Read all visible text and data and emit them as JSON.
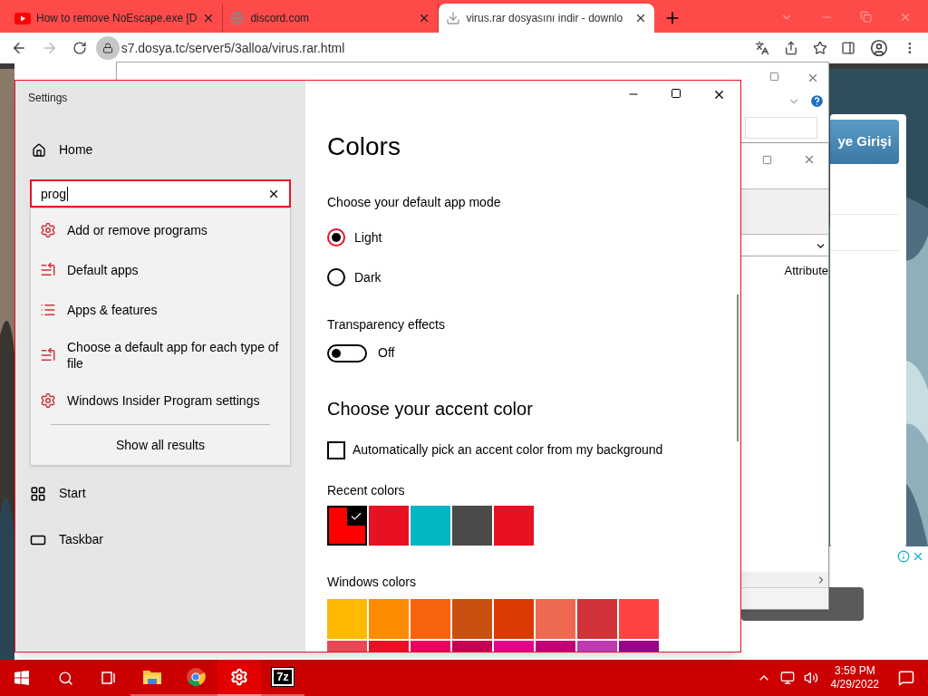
{
  "browser": {
    "tabs": [
      {
        "title": "How to remove NoEscape.exe [D",
        "kind": "video",
        "selected": false
      },
      {
        "title": "discord.com",
        "kind": "web",
        "selected": false
      },
      {
        "title": "virus.rar dosyasını indir - downlo",
        "kind": "download",
        "selected": true
      }
    ],
    "nav": {
      "forward_enabled": false
    },
    "address": {
      "url": "s7.dosya.tc/server5/3alloa/virus.rar.html"
    }
  },
  "background": {
    "page_button": "ye Girişi",
    "explorer_column": "Attribute"
  },
  "settings": {
    "title": "Settings",
    "home": "Home",
    "search": {
      "value": "prog"
    },
    "results": [
      {
        "label": "Add or remove programs",
        "kind": "gear"
      },
      {
        "label": "Default apps",
        "kind": "list-arrow"
      },
      {
        "label": "Apps & features",
        "kind": "list"
      },
      {
        "label": "Choose a default app for each type of file",
        "kind": "list-arrow"
      },
      {
        "label": "Windows Insider Program settings",
        "kind": "gear"
      }
    ],
    "show_all": "Show all results",
    "nav_items": [
      {
        "label": "Start",
        "kind": "start"
      },
      {
        "label": "Taskbar",
        "kind": "taskbar"
      }
    ],
    "page": {
      "title": "Colors",
      "app_mode": {
        "label": "Choose your default app mode",
        "options": [
          {
            "label": "Light",
            "selected": true
          },
          {
            "label": "Dark",
            "selected": false
          }
        ]
      },
      "transparency": {
        "label": "Transparency effects",
        "on": false,
        "state_text": "Off"
      },
      "accent_heading": "Choose your accent color",
      "auto_pick": {
        "label": "Automatically pick an accent color from my background",
        "checked": false
      },
      "recent": {
        "label": "Recent colors",
        "swatches": [
          {
            "color": "#ff0000",
            "selected": true
          },
          {
            "color": "#e81123",
            "selected": false
          },
          {
            "color": "#00b7c3",
            "selected": false
          },
          {
            "color": "#4c4a48",
            "selected": false
          },
          {
            "color": "#e81123",
            "selected": false
          }
        ]
      },
      "windows_colors": {
        "label": "Windows colors",
        "swatches": [
          {
            "color": "#ffb900",
            "selected": false
          },
          {
            "color": "#ff8c00",
            "selected": false
          },
          {
            "color": "#f7630c",
            "selected": false
          },
          {
            "color": "#ca5010",
            "selected": false
          },
          {
            "color": "#da3b01",
            "selected": false
          },
          {
            "color": "#ef6950",
            "selected": false
          },
          {
            "color": "#d13438",
            "selected": false
          },
          {
            "color": "#ff4343",
            "selected": false
          },
          {
            "color": "#e74856",
            "selected": false
          },
          {
            "color": "#e81123",
            "selected": false
          },
          {
            "color": "#ea005e",
            "selected": false
          },
          {
            "color": "#c30052",
            "selected": false
          },
          {
            "color": "#e3008c",
            "selected": false
          },
          {
            "color": "#bf0077",
            "selected": false
          },
          {
            "color": "#c239b3",
            "selected": false
          },
          {
            "color": "#9a0089",
            "selected": false
          }
        ]
      }
    }
  },
  "taskbar": {
    "apps": [
      {
        "kind": "explorer",
        "active": false
      },
      {
        "kind": "chrome",
        "active": false
      },
      {
        "kind": "settings",
        "active": true
      },
      {
        "kind": "archiver",
        "label": "7z",
        "active": false
      }
    ],
    "time": "3:59 PM",
    "date": "4/29/2022"
  }
}
